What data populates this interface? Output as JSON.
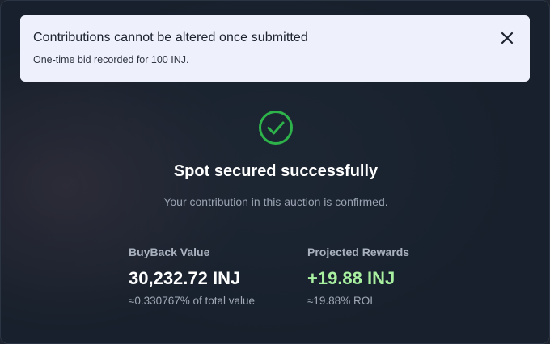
{
  "toast": {
    "title": "Contributions cannot be altered once submitted",
    "message": "One-time bid recorded for 100 INJ.",
    "close_icon": "close-icon"
  },
  "status": {
    "icon": "check-circle-icon",
    "icon_color": "#2db34a",
    "title": "Spot secured successfully",
    "subtitle": "Your contribution in this auction is confirmed."
  },
  "stats": {
    "buyback": {
      "label": "BuyBack Value",
      "value": "30,232.72 INJ",
      "note": "≈0.330767% of total value"
    },
    "rewards": {
      "label": "Projected Rewards",
      "value": "+19.88 INJ",
      "value_color": "#a8f0a0",
      "note": "≈19.88% ROI"
    }
  }
}
